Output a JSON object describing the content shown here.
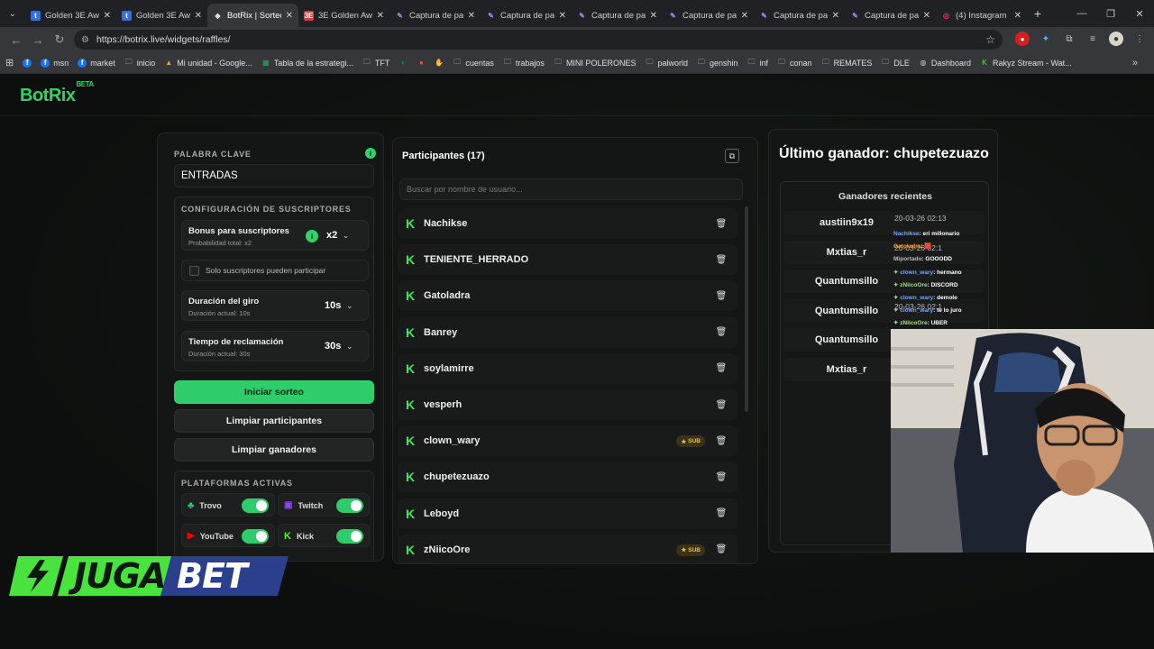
{
  "browser": {
    "tabs": [
      {
        "label": "Golden 3E Aw",
        "favicon_color": "#3b6fd8",
        "favicon": "t",
        "active": false
      },
      {
        "label": "Golden 3E Aw",
        "favicon_color": "#3b6fd8",
        "favicon": "t",
        "active": false
      },
      {
        "label": "BotRix | Sorteo",
        "favicon_color": "#e5e5e5",
        "favicon": "◆",
        "active": true
      },
      {
        "label": "3E Golden Aw",
        "favicon_color": "#d63c3c",
        "favicon": "3E",
        "active": false
      },
      {
        "label": "Captura de pa",
        "favicon_color": "#b07fe8",
        "favicon": "✎",
        "active": false
      },
      {
        "label": "Captura de pa",
        "favicon_color": "#b07fe8",
        "favicon": "✎",
        "active": false
      },
      {
        "label": "Captura de pa",
        "favicon_color": "#b07fe8",
        "favicon": "✎",
        "active": false
      },
      {
        "label": "Captura de pa",
        "favicon_color": "#b07fe8",
        "favicon": "✎",
        "active": false
      },
      {
        "label": "Captura de pa",
        "favicon_color": "#b07fe8",
        "favicon": "✎",
        "active": false
      },
      {
        "label": "Captura de pa",
        "favicon_color": "#b07fe8",
        "favicon": "✎",
        "active": false
      },
      {
        "label": "(4) Instagram",
        "favicon_color": "#e1306c",
        "favicon": "◎",
        "active": false
      }
    ],
    "url": "https://botrix.live/widgets/raffles/",
    "bookmarks": [
      {
        "label": "",
        "icon": "f",
        "color": "#1877f2"
      },
      {
        "label": "msn",
        "icon": "f",
        "color": "#1877f2"
      },
      {
        "label": "market",
        "icon": "f",
        "color": "#1877f2"
      },
      {
        "label": "inicio",
        "icon": "folder",
        "color": "#ccc"
      },
      {
        "label": "Mi unidad - Google...",
        "icon": "drive",
        "color": "#f4b400"
      },
      {
        "label": "Tabla de la estrategi...",
        "icon": "sheet",
        "color": "#34a853"
      },
      {
        "label": "TFT",
        "icon": "folder",
        "color": "#ccc"
      },
      {
        "label": "",
        "icon": "tft",
        "color": "#1f8a70"
      },
      {
        "label": "",
        "icon": "circle",
        "color": "#f25022"
      },
      {
        "label": "",
        "icon": "claw",
        "color": "#d42020"
      },
      {
        "label": "cuentas",
        "icon": "folder",
        "color": "#ccc"
      },
      {
        "label": "trabajos",
        "icon": "folder",
        "color": "#ccc"
      },
      {
        "label": "MINI POLERONES",
        "icon": "folder",
        "color": "#ccc"
      },
      {
        "label": "palworld",
        "icon": "folder",
        "color": "#ccc"
      },
      {
        "label": "genshin",
        "icon": "folder",
        "color": "#ccc"
      },
      {
        "label": "inf",
        "icon": "folder",
        "color": "#ccc"
      },
      {
        "label": "conan",
        "icon": "folder",
        "color": "#ccc"
      },
      {
        "label": "REMATES",
        "icon": "folder",
        "color": "#ccc"
      },
      {
        "label": "DLE",
        "icon": "folder",
        "color": "#ccc"
      },
      {
        "label": "Dashboard",
        "icon": "globe",
        "color": "#ccc"
      },
      {
        "label": "Rakyz Stream - Wat...",
        "icon": "kick",
        "color": "#53fc18"
      }
    ]
  },
  "app": {
    "logo": "BotRix",
    "logo_badge": "BETA",
    "accent": "#2ecc6a"
  },
  "settings": {
    "keyword_label": "PALABRA CLAVE",
    "keyword_value": "ENTRADAS",
    "subs_section": "CONFIGURACIÓN DE SUSCRIPTORES",
    "bonus_title": "Bonus para suscriptores",
    "bonus_sub": "Probabilidad total: x2",
    "bonus_value": "x2",
    "only_subs": "Solo suscriptores pueden participar",
    "spin_title": "Duración del giro",
    "spin_sub": "Duración actual: 10s",
    "spin_value": "10s",
    "claim_title": "Tiempo de reclamación",
    "claim_sub": "Duración actual: 30s",
    "claim_value": "30s",
    "start_button": "Iniciar sorteo",
    "clear_participants": "Limpiar participantes",
    "clear_winners": "Limpiar ganadores",
    "platforms_label": "PLATAFORMAS ACTIVAS",
    "platforms": [
      {
        "name": "Trovo",
        "icon": "trovo-icon",
        "color": "#1ed37c",
        "enabled": true
      },
      {
        "name": "Twitch",
        "icon": "twitch-icon",
        "color": "#9146ff",
        "enabled": true
      },
      {
        "name": "YouTube",
        "icon": "youtube-icon",
        "color": "#ff0000",
        "enabled": true
      },
      {
        "name": "Kick",
        "icon": "kick-icon",
        "color": "#53fc18",
        "enabled": true
      }
    ]
  },
  "participants": {
    "title": "Participantes (17)",
    "search_placeholder": "Buscar por nombre de usuario...",
    "sub_badge": "SUB",
    "list": [
      {
        "name": "Nachikse",
        "sub": false
      },
      {
        "name": "TENIENTE_HERRADO",
        "sub": false
      },
      {
        "name": "Gatoladra",
        "sub": false
      },
      {
        "name": "Banrey",
        "sub": false
      },
      {
        "name": "soylamirre",
        "sub": false
      },
      {
        "name": "vesperh",
        "sub": false
      },
      {
        "name": "clown_wary",
        "sub": true
      },
      {
        "name": "chupetezuazo",
        "sub": false
      },
      {
        "name": "Leboyd",
        "sub": false
      },
      {
        "name": "zNiicoOre",
        "sub": true
      }
    ]
  },
  "winners": {
    "last_winner": "Último ganador: chupetezuazo",
    "recent_title": "Ganadores recientes",
    "list": [
      {
        "name": "austiin9x19",
        "date": "20-03-26 02:13"
      },
      {
        "name": "Mxtias_r",
        "date": "20-03-26 02:1"
      },
      {
        "name": "Quantumsillo",
        "date": ""
      },
      {
        "name": "Quantumsillo",
        "date": "20-03-26 02:1"
      },
      {
        "name": "Quantumsillo",
        "date": ""
      },
      {
        "name": "Mxtias_r",
        "date": "2"
      }
    ]
  },
  "chat_overlay": [
    {
      "user": "Nachikse",
      "msg": ": eri millonario",
      "color": "#7aa7ff"
    },
    {
      "user": "Gatoladra",
      "msg": ": 🟥",
      "color": "#f0a040"
    },
    {
      "user": "Miportado",
      "msg": ": GOOODD",
      "color": "#bbbbbb"
    },
    {
      "user": "clown_wary",
      "msg": ": hermano",
      "color": "#7aa7ff"
    },
    {
      "user": "zNiicoOre",
      "msg": ": DISCORD",
      "color": "#9ee37d"
    },
    {
      "user": "clown_wary",
      "msg": ": demole",
      "color": "#7aa7ff"
    },
    {
      "user": "clown_wary",
      "msg": ": te lo juro",
      "color": "#7aa7ff"
    },
    {
      "user": "zNiicoOre",
      "msg": ": UBER",
      "color": "#9ee37d"
    }
  ],
  "sponsor": {
    "text_left": "JUGA",
    "text_right": "BET"
  }
}
